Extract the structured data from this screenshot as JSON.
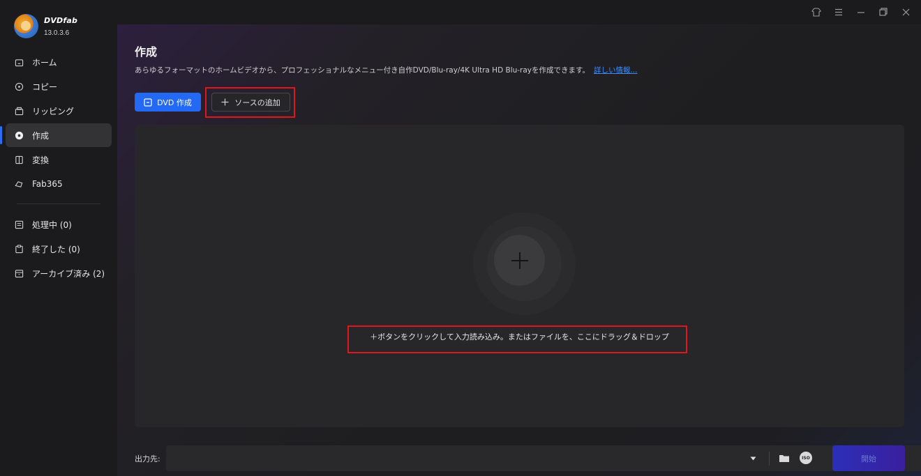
{
  "app": {
    "name": "DVDfab",
    "version": "13.0.3.6"
  },
  "sidebar": {
    "items": [
      {
        "label": "ホーム",
        "icon": "home-icon"
      },
      {
        "label": "コピー",
        "icon": "copy-icon"
      },
      {
        "label": "リッピング",
        "icon": "ripper-icon"
      },
      {
        "label": "作成",
        "icon": "creator-icon",
        "active": true
      },
      {
        "label": "変換",
        "icon": "converter-icon"
      },
      {
        "label": "Fab365",
        "icon": "fab365-icon"
      }
    ],
    "queue": [
      {
        "label": "処理中 (0)",
        "icon": "processing-icon"
      },
      {
        "label": "終了した (0)",
        "icon": "finished-icon"
      },
      {
        "label": "アーカイブ済み (2)",
        "icon": "archive-icon"
      }
    ]
  },
  "window": {
    "controls": [
      "shirt-icon",
      "menu-icon",
      "minimize-icon",
      "restore-icon",
      "close-icon"
    ]
  },
  "main": {
    "title": "作成",
    "description": "あらゆるフォーマットのホームビデオから、プロフェッショナルなメニュー付き自作DVD/Blu-ray/4K Ultra HD Blu-rayを作成できます。",
    "more_link": "詳しい情報...",
    "mode_button": "DVD 作成",
    "add_source_button": "ソースの追加",
    "drop_hint": "＋ボタンをクリックして入力読み込み。またはファイルを、ここにドラッグ＆ドロップ",
    "output_label": "出力先:",
    "iso_label": "ISO",
    "start_button": "開始"
  },
  "colors": {
    "accent": "#2469f3",
    "highlight": "#e0161d",
    "start": "#2b2fb8"
  }
}
